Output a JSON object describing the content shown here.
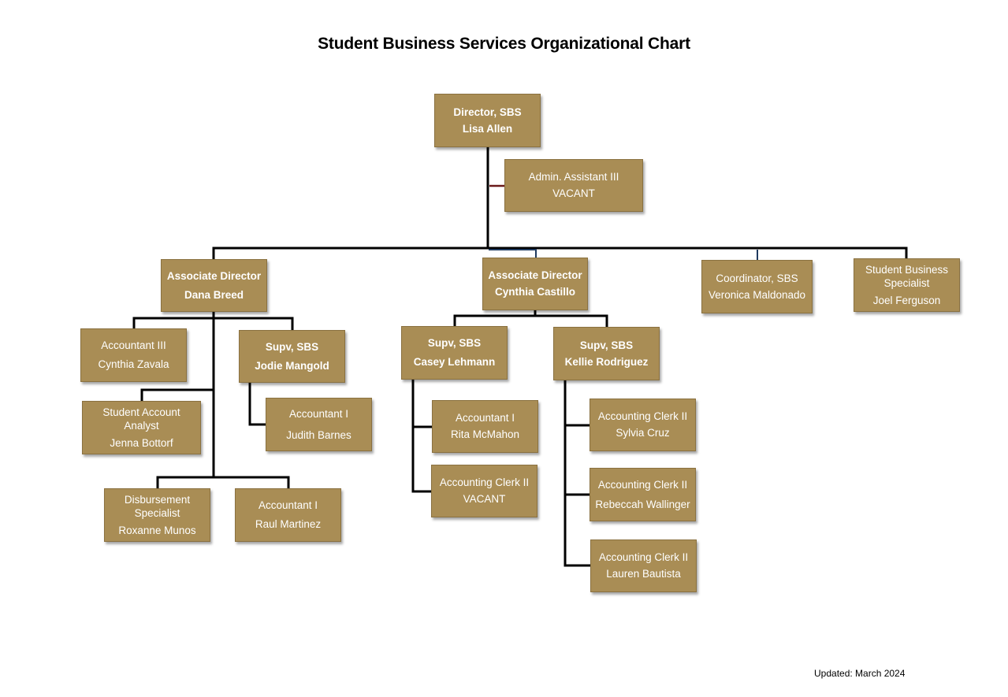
{
  "title": "Student Business Services Organizational Chart",
  "updated": "Updated: March 2024",
  "colors": {
    "box_fill": "#a98d55",
    "box_text": "#ffffff",
    "connector": "#000000",
    "admin_connector": "#6b1a1a",
    "staff_connector": "#1f3a5f"
  },
  "nodes": {
    "director": {
      "title": "Director, SBS",
      "name": "Lisa Allen"
    },
    "admin_assistant": {
      "title": "Admin. Assistant III",
      "name": "VACANT"
    },
    "assoc_dir_breed": {
      "title": "Associate Director",
      "name": "Dana Breed"
    },
    "assoc_dir_castillo": {
      "title": "Associate Director",
      "name": "Cynthia Castillo"
    },
    "coordinator": {
      "title": "Coordinator, SBS",
      "name": "Veronica Maldonado"
    },
    "sbs_specialist": {
      "title": "Student Business Specialist",
      "name": "Joel Ferguson"
    },
    "accountant3_zavala": {
      "title": "Accountant III",
      "name": "Cynthia Zavala"
    },
    "supv_mangold": {
      "title": "Supv, SBS",
      "name": "Jodie Mangold"
    },
    "saa_bottorf": {
      "title": "Student Account Analyst",
      "name": "Jenna Bottorf"
    },
    "accountant1_barnes": {
      "title": "Accountant I",
      "name": "Judith Barnes"
    },
    "disb_munos": {
      "title": "Disbursement Specialist",
      "name": "Roxanne Munos"
    },
    "accountant1_martinez": {
      "title": "Accountant I",
      "name": "Raul Martinez"
    },
    "supv_lehmann": {
      "title": "Supv, SBS",
      "name": "Casey Lehmann"
    },
    "supv_rodriguez": {
      "title": "Supv, SBS",
      "name": "Kellie Rodriguez"
    },
    "accountant1_mcmahon": {
      "title": "Accountant I",
      "name": "Rita McMahon"
    },
    "clerk2_vacant": {
      "title": "Accounting Clerk II",
      "name": "VACANT"
    },
    "clerk2_cruz": {
      "title": "Accounting Clerk II",
      "name": "Sylvia Cruz"
    },
    "clerk2_wallinger": {
      "title": "Accounting Clerk II",
      "name": "Rebeccah Wallinger"
    },
    "clerk2_bautista": {
      "title": "Accounting Clerk II",
      "name": "Lauren Bautista"
    }
  },
  "reporting": [
    [
      "director",
      "admin_assistant"
    ],
    [
      "director",
      "assoc_dir_breed"
    ],
    [
      "director",
      "assoc_dir_castillo"
    ],
    [
      "director",
      "coordinator"
    ],
    [
      "director",
      "sbs_specialist"
    ],
    [
      "assoc_dir_breed",
      "accountant3_zavala"
    ],
    [
      "assoc_dir_breed",
      "supv_mangold"
    ],
    [
      "assoc_dir_breed",
      "saa_bottorf"
    ],
    [
      "assoc_dir_breed",
      "disb_munos"
    ],
    [
      "assoc_dir_breed",
      "accountant1_martinez"
    ],
    [
      "supv_mangold",
      "accountant1_barnes"
    ],
    [
      "assoc_dir_castillo",
      "supv_lehmann"
    ],
    [
      "assoc_dir_castillo",
      "supv_rodriguez"
    ],
    [
      "supv_lehmann",
      "accountant1_mcmahon"
    ],
    [
      "supv_lehmann",
      "clerk2_vacant"
    ],
    [
      "supv_rodriguez",
      "clerk2_cruz"
    ],
    [
      "supv_rodriguez",
      "clerk2_wallinger"
    ],
    [
      "supv_rodriguez",
      "clerk2_bautista"
    ]
  ]
}
